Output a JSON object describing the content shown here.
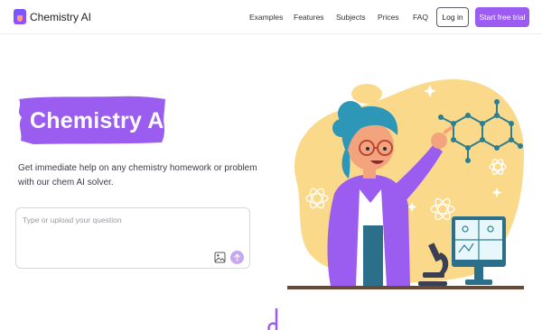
{
  "brand": {
    "name": "Chemistry AI",
    "logo_icon": "flask-icon"
  },
  "nav": {
    "items": [
      {
        "label": "Examples"
      },
      {
        "label": "Features"
      },
      {
        "label": "Subjects"
      },
      {
        "label": "Prices"
      },
      {
        "label": "FAQ"
      }
    ],
    "login_label": "Log in",
    "trial_label": "Start free trial"
  },
  "hero": {
    "title": "Chemistry AI",
    "description": "Get immediate help on any chemistry homework or problem with our chem AI solver."
  },
  "query": {
    "placeholder": "Type or upload your question",
    "upload_icon": "image-upload-icon",
    "send_icon": "arrow-up-icon"
  },
  "colors": {
    "accent": "#9c5cf2",
    "title_bg": "#9b5df0",
    "illustration_yellow": "#fbd98a",
    "send_button": "#c7a6f6"
  }
}
